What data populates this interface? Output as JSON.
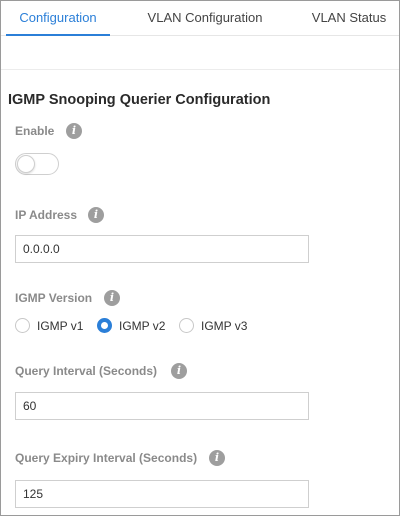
{
  "tabs": [
    {
      "label": "Configuration",
      "active": true
    },
    {
      "label": "VLAN Configuration",
      "active": false
    },
    {
      "label": "VLAN Status",
      "active": false
    }
  ],
  "section": {
    "title": "IGMP Snooping Querier Configuration"
  },
  "fields": {
    "enable": {
      "label": "Enable",
      "value": false,
      "info_icon": "info-icon"
    },
    "ip_address": {
      "label": "IP Address",
      "value": "0.0.0.0",
      "info_icon": "info-icon"
    },
    "igmp_version": {
      "label": "IGMP Version",
      "info_icon": "info-icon",
      "options": [
        "IGMP v1",
        "IGMP v2",
        "IGMP v3"
      ],
      "selected": "IGMP v2"
    },
    "query_interval": {
      "label": "Query Interval (Seconds)",
      "value": "60",
      "info_icon": "info-icon"
    },
    "query_expiry_interval": {
      "label": "Query Expiry Interval (Seconds)",
      "value": "125",
      "info_icon": "info-icon"
    }
  },
  "colors": {
    "accent": "#2b7fd8",
    "label": "#8a8a8a",
    "info_icon_bg": "#9e9e9e"
  },
  "info_glyph": "i"
}
